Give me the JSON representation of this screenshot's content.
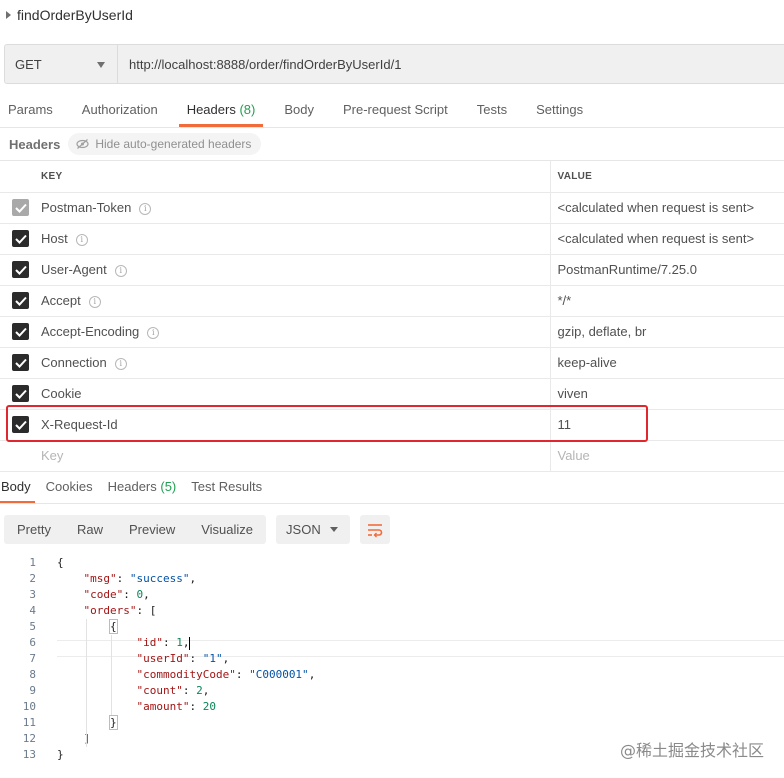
{
  "request": {
    "name": "findOrderByUserId",
    "method": "GET",
    "url": "http://localhost:8888/order/findOrderByUserId/1"
  },
  "request_tabs": [
    {
      "label": "Params"
    },
    {
      "label": "Authorization"
    },
    {
      "label": "Headers",
      "count": "(8)"
    },
    {
      "label": "Body"
    },
    {
      "label": "Pre-request Script"
    },
    {
      "label": "Tests"
    },
    {
      "label": "Settings"
    }
  ],
  "headers_section": {
    "label": "Headers",
    "hide_button": "Hide auto-generated headers",
    "col_key": "KEY",
    "col_value": "VALUE",
    "rows": [
      {
        "key": "Postman-Token",
        "value": "<calculated when request is sent>",
        "info": true,
        "checked": true,
        "disabled": true
      },
      {
        "key": "Host",
        "value": "<calculated when request is sent>",
        "info": true,
        "checked": true
      },
      {
        "key": "User-Agent",
        "value": "PostmanRuntime/7.25.0",
        "info": true,
        "checked": true
      },
      {
        "key": "Accept",
        "value": "*/*",
        "info": true,
        "checked": true
      },
      {
        "key": "Accept-Encoding",
        "value": "gzip, deflate, br",
        "info": true,
        "checked": true
      },
      {
        "key": "Connection",
        "value": "keep-alive",
        "info": true,
        "checked": true
      },
      {
        "key": "Cookie",
        "value": "viven",
        "info": false,
        "checked": true
      },
      {
        "key": "X-Request-Id",
        "value": "11",
        "info": false,
        "checked": true
      }
    ],
    "placeholder_key": "Key",
    "placeholder_value": "Value"
  },
  "response_tabs": [
    {
      "label": "Body"
    },
    {
      "label": "Cookies"
    },
    {
      "label": "Headers",
      "count": "(5)"
    },
    {
      "label": "Test Results"
    }
  ],
  "view_modes": [
    "Pretty",
    "Raw",
    "Preview",
    "Visualize"
  ],
  "format": "JSON",
  "code_lines": [
    {
      "n": "1",
      "text": "{"
    },
    {
      "n": "2",
      "text": "    \"msg\": \"success\","
    },
    {
      "n": "3",
      "text": "    \"code\": 0,"
    },
    {
      "n": "4",
      "text": "    \"orders\": ["
    },
    {
      "n": "5",
      "text": "        {"
    },
    {
      "n": "6",
      "text": "            \"id\": 1,"
    },
    {
      "n": "7",
      "text": "            \"userId\": \"1\","
    },
    {
      "n": "8",
      "text": "            \"commodityCode\": \"C000001\","
    },
    {
      "n": "9",
      "text": "            \"count\": 2,"
    },
    {
      "n": "10",
      "text": "            \"amount\": 20"
    },
    {
      "n": "11",
      "text": "        }"
    },
    {
      "n": "12",
      "text": "    ]"
    },
    {
      "n": "13",
      "text": "}"
    }
  ],
  "watermark": "@稀土掘金技术社区",
  "colors": {
    "accent": "#f26b3a",
    "count": "#22a052",
    "highlight": "#e0262e"
  }
}
